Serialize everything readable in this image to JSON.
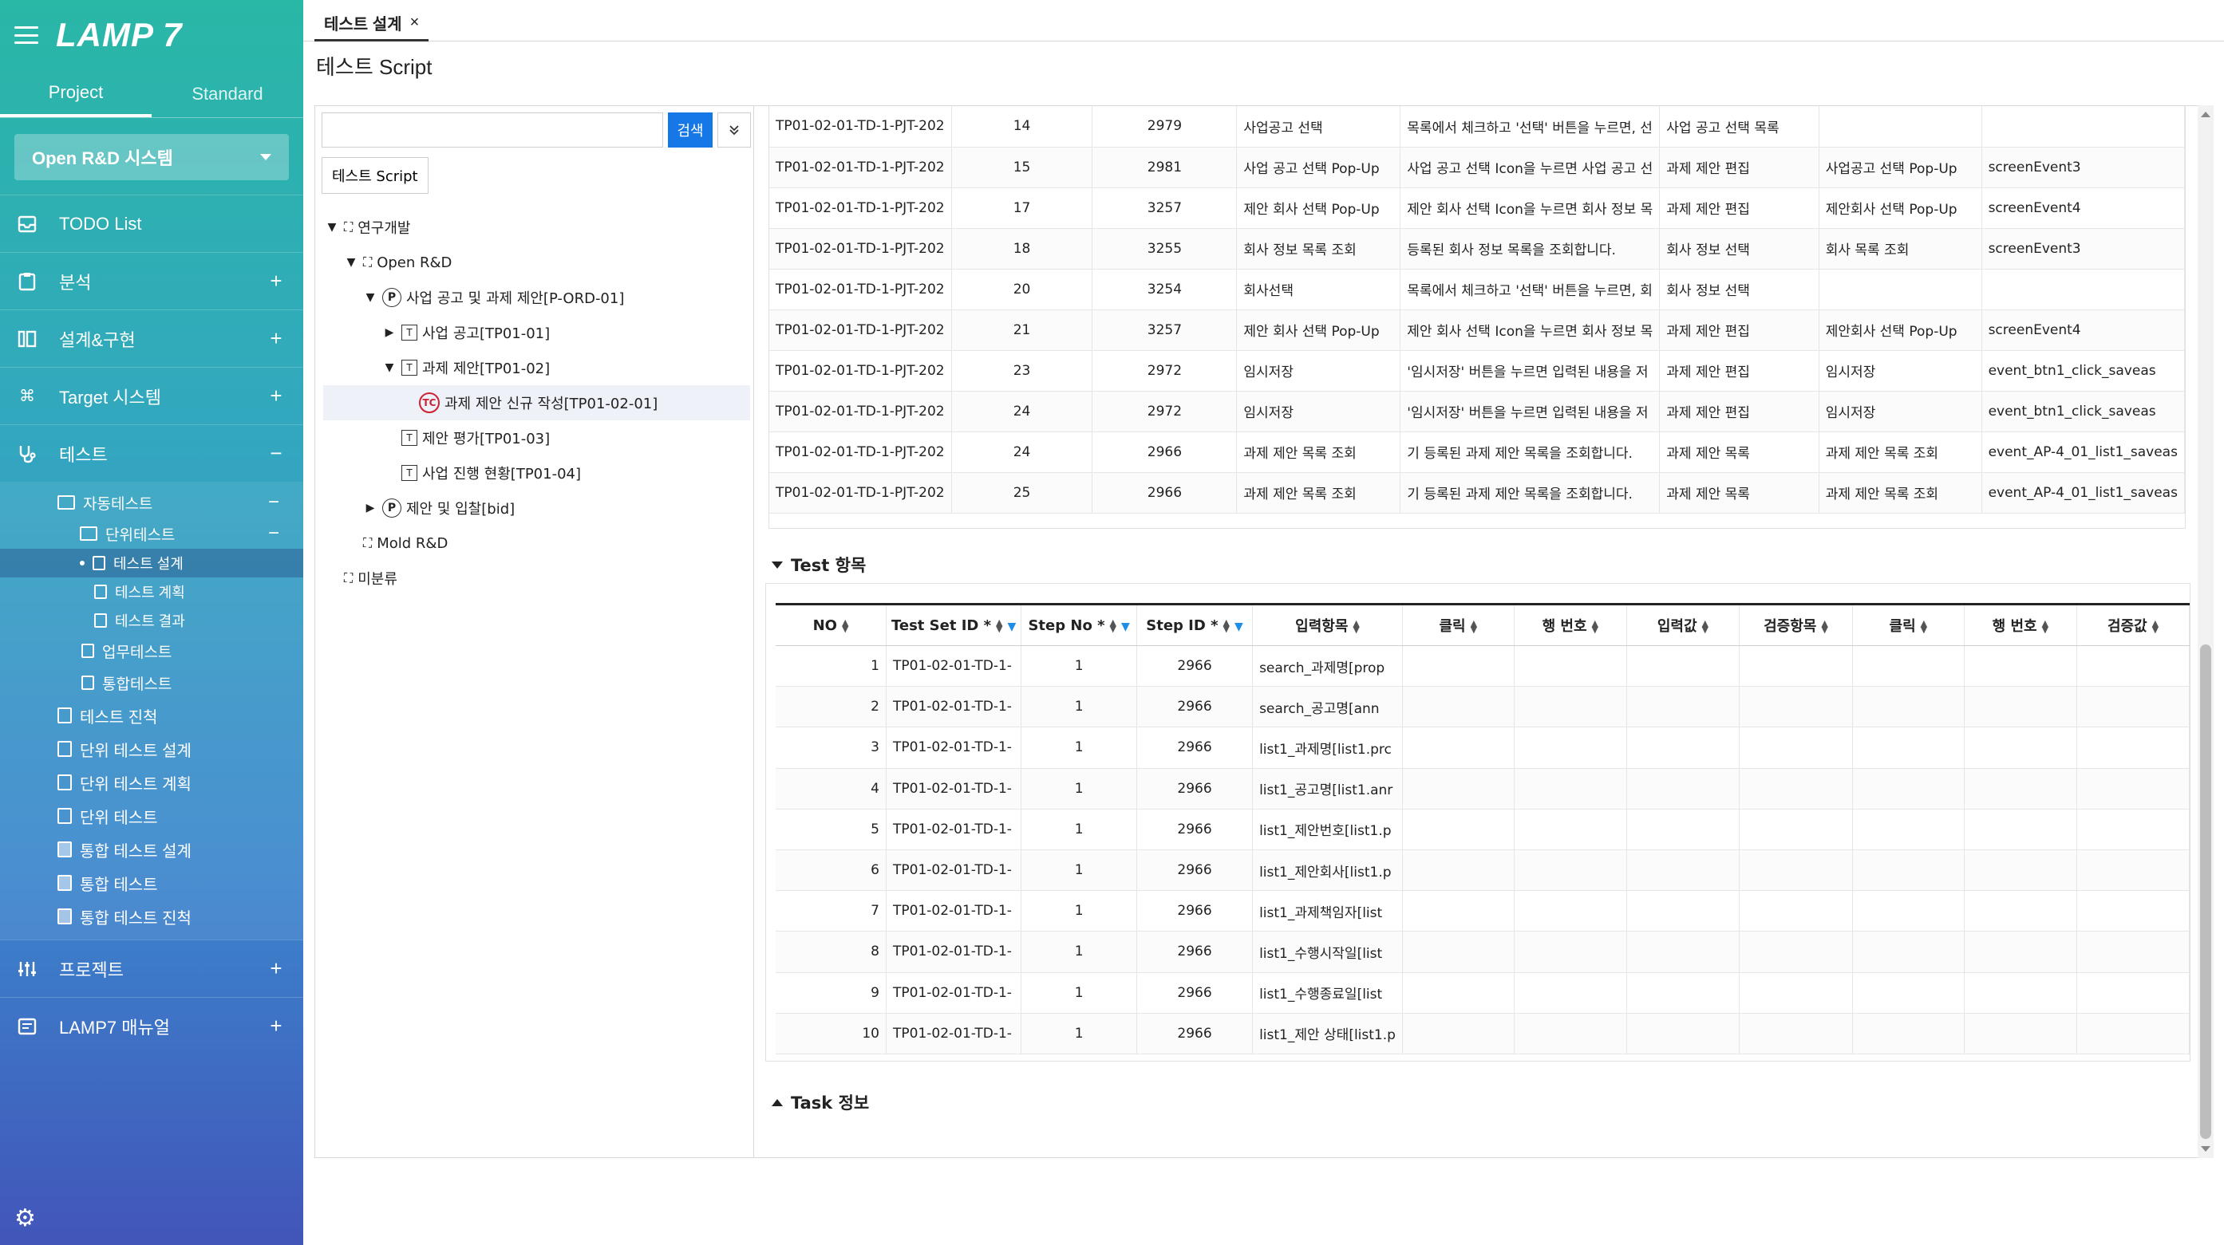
{
  "app": {
    "logo": "LAMP 7"
  },
  "sidebar": {
    "tabs": [
      "Project",
      "Standard"
    ],
    "system": "Open R&D 시스템",
    "menu": {
      "todo": "TODO List",
      "analysis": "분석",
      "design": "설계&구현",
      "target": "Target 시스템",
      "test": "테스트",
      "project": "프로젝트",
      "manual": "LAMP7 매뉴얼"
    },
    "sub": {
      "auto_test": "자동테스트",
      "unit_test": "단위테스트",
      "test_design": "테스트 설계",
      "test_plan": "테스트 계획",
      "test_result": "테스트 결과",
      "business_test": "업무테스트",
      "integration_test": "통합테스트",
      "test_progress": "테스트 진척",
      "unit_test_design": "단위 테스트 설계",
      "unit_test_plan": "단위 테스트 계획",
      "unit_test_run": "단위 테스트",
      "int_test_design": "통합 테스트 설계",
      "int_test_run": "통합 테스트",
      "int_test_progress": "통합 테스트 진척"
    }
  },
  "tabs": {
    "active": "테스트 설계",
    "close": "×"
  },
  "page_title": "테스트 Script",
  "tree_panel": {
    "search_button": "검색",
    "expand_icon": "⌄⌄",
    "script_button": "테스트 Script",
    "nodes": {
      "root": "연구개발",
      "open_rd": "Open R&D",
      "p_ord": "사업 공고 및 과제 제안[P-ORD-01]",
      "tp0101": "사업 공고[TP01-01]",
      "tp0102": "과제 제안[TP01-02]",
      "tc": "과제 제안 신규 작성[TP01-02-01]",
      "tp0103": "제안 평가[TP01-03]",
      "tp0104": "사업 진행 현황[TP01-04]",
      "bid": "제안 및 입찰[bid]",
      "mold": "Mold R&D",
      "uncategorized": "미분류"
    },
    "tc_badge": "TC",
    "p_badge": "P"
  },
  "upper_table": {
    "rows": [
      [
        "TP01-02-01-TD-1-PJT-202",
        "14",
        "2979",
        "사업공고 선택",
        "목록에서 체크하고 '선택' 버튼을 누르면, 선",
        "사업 공고 선택 목록",
        "",
        ""
      ],
      [
        "TP01-02-01-TD-1-PJT-202",
        "15",
        "2981",
        "사업 공고 선택 Pop-Up",
        "사업 공고 선택 Icon을 누르면 사업 공고 선",
        "과제 제안 편집",
        "사업공고 선택 Pop-Up",
        "screenEvent3"
      ],
      [
        "TP01-02-01-TD-1-PJT-202",
        "17",
        "3257",
        "제안 회사 선택 Pop-Up",
        "제안 회사 선택 Icon을 누르면 회사 정보 목",
        "과제 제안 편집",
        "제안회사 선택 Pop-Up",
        "screenEvent4"
      ],
      [
        "TP01-02-01-TD-1-PJT-202",
        "18",
        "3255",
        "회사 정보 목록 조회",
        "등록된 회사 정보 목록을 조회합니다.",
        "회사 정보 선택",
        "회사 목록 조회",
        "screenEvent3"
      ],
      [
        "TP01-02-01-TD-1-PJT-202",
        "20",
        "3254",
        "회사선택",
        "목록에서 체크하고 '선택' 버튼을 누르면, 회",
        "회사 정보 선택",
        "",
        ""
      ],
      [
        "TP01-02-01-TD-1-PJT-202",
        "21",
        "3257",
        "제안 회사 선택 Pop-Up",
        "제안 회사 선택 Icon을 누르면 회사 정보 목",
        "과제 제안 편집",
        "제안회사 선택 Pop-Up",
        "screenEvent4"
      ],
      [
        "TP01-02-01-TD-1-PJT-202",
        "23",
        "2972",
        "임시저장",
        "'임시저장' 버튼을 누르면 입력된 내용을 저",
        "과제 제안 편집",
        "임시저장",
        "event_btn1_click_saveas"
      ],
      [
        "TP01-02-01-TD-1-PJT-202",
        "24",
        "2972",
        "임시저장",
        "'임시저장' 버튼을 누르면 입력된 내용을 저",
        "과제 제안 편집",
        "임시저장",
        "event_btn1_click_saveas"
      ],
      [
        "TP01-02-01-TD-1-PJT-202",
        "24",
        "2966",
        "과제 제안 목록 조회",
        "기 등록된 과제 제안 목록을 조회합니다.",
        "과제 제안 목록",
        "과제 제안 목록 조회",
        "event_AP-4_01_list1_saveas"
      ],
      [
        "TP01-02-01-TD-1-PJT-202",
        "25",
        "2966",
        "과제 제안 목록 조회",
        "기 등록된 과제 제안 목록을 조회합니다.",
        "과제 제안 목록",
        "과제 제안 목록 조회",
        "event_AP-4_01_list1_saveas"
      ]
    ]
  },
  "test_section": {
    "title": "Test 항목",
    "headers": [
      "NO",
      "Test Set ID *",
      "Step No *",
      "Step ID *",
      "입력항목",
      "클릭",
      "행 번호",
      "입력값",
      "검증항목",
      "클릭",
      "행 번호",
      "검증값"
    ],
    "rows": [
      [
        "1",
        "TP01-02-01-TD-1-",
        "1",
        "2966",
        "search_과제명[prop"
      ],
      [
        "2",
        "TP01-02-01-TD-1-",
        "1",
        "2966",
        "search_공고명[ann"
      ],
      [
        "3",
        "TP01-02-01-TD-1-",
        "1",
        "2966",
        "list1_과제명[list1.prc"
      ],
      [
        "4",
        "TP01-02-01-TD-1-",
        "1",
        "2966",
        "list1_공고명[list1.anr"
      ],
      [
        "5",
        "TP01-02-01-TD-1-",
        "1",
        "2966",
        "list1_제안번호[list1.p"
      ],
      [
        "6",
        "TP01-02-01-TD-1-",
        "1",
        "2966",
        "list1_제안회사[list1.p"
      ],
      [
        "7",
        "TP01-02-01-TD-1-",
        "1",
        "2966",
        "list1_과제책임자[list"
      ],
      [
        "8",
        "TP01-02-01-TD-1-",
        "1",
        "2966",
        "list1_수행시작일[list"
      ],
      [
        "9",
        "TP01-02-01-TD-1-",
        "1",
        "2966",
        "list1_수행종료일[list"
      ],
      [
        "10",
        "TP01-02-01-TD-1-",
        "1",
        "2966",
        "list1_제안 상태[list1.p"
      ]
    ]
  },
  "task_section": {
    "title": "Task 정보"
  },
  "icons": {
    "menu": "hamburger-icon",
    "todo": "inbox-icon",
    "analysis": "clipboard-icon",
    "design": "columns-icon",
    "target": "command-icon",
    "test": "stethoscope-icon",
    "project": "sliders-icon",
    "manual": "manual-icon",
    "settings": "gear-icon"
  },
  "colors": {
    "primary": "#1677e6",
    "accent": "#29b7a6"
  }
}
